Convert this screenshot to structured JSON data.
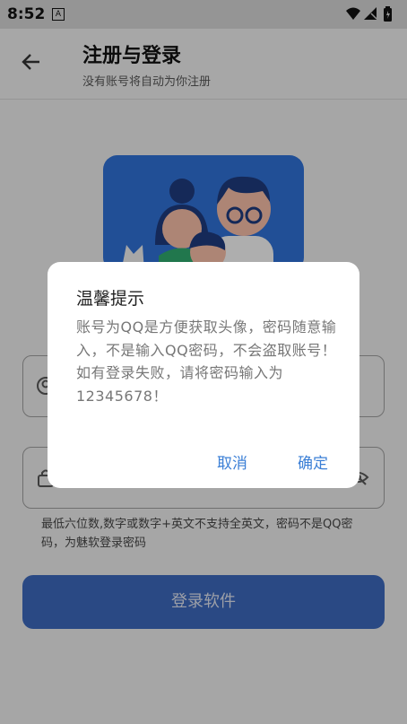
{
  "statusbar": {
    "time": "8:52",
    "notif_icon": "A"
  },
  "appbar": {
    "title": "注册与登录",
    "subtitle": "没有账号将自动为你注册"
  },
  "form": {
    "hint": "最低六位数,数字或数字+英文不支持全英文，密码不是QQ密码，为魅软登录密码",
    "login_button": "登录软件"
  },
  "dialog": {
    "title": "温馨提示",
    "message_line1": "账号为QQ是方便获取头像，密码随意输入，不是输入QQ密码，不会盗取账号！",
    "message_line2": "如有登录失败，请将密码输入为12345678！",
    "cancel": "取消",
    "confirm": "确定"
  },
  "colors": {
    "primary": "#3b66b8",
    "dialog_button": "#3b7fd6",
    "illustration_bg": "#2f6ed0"
  }
}
